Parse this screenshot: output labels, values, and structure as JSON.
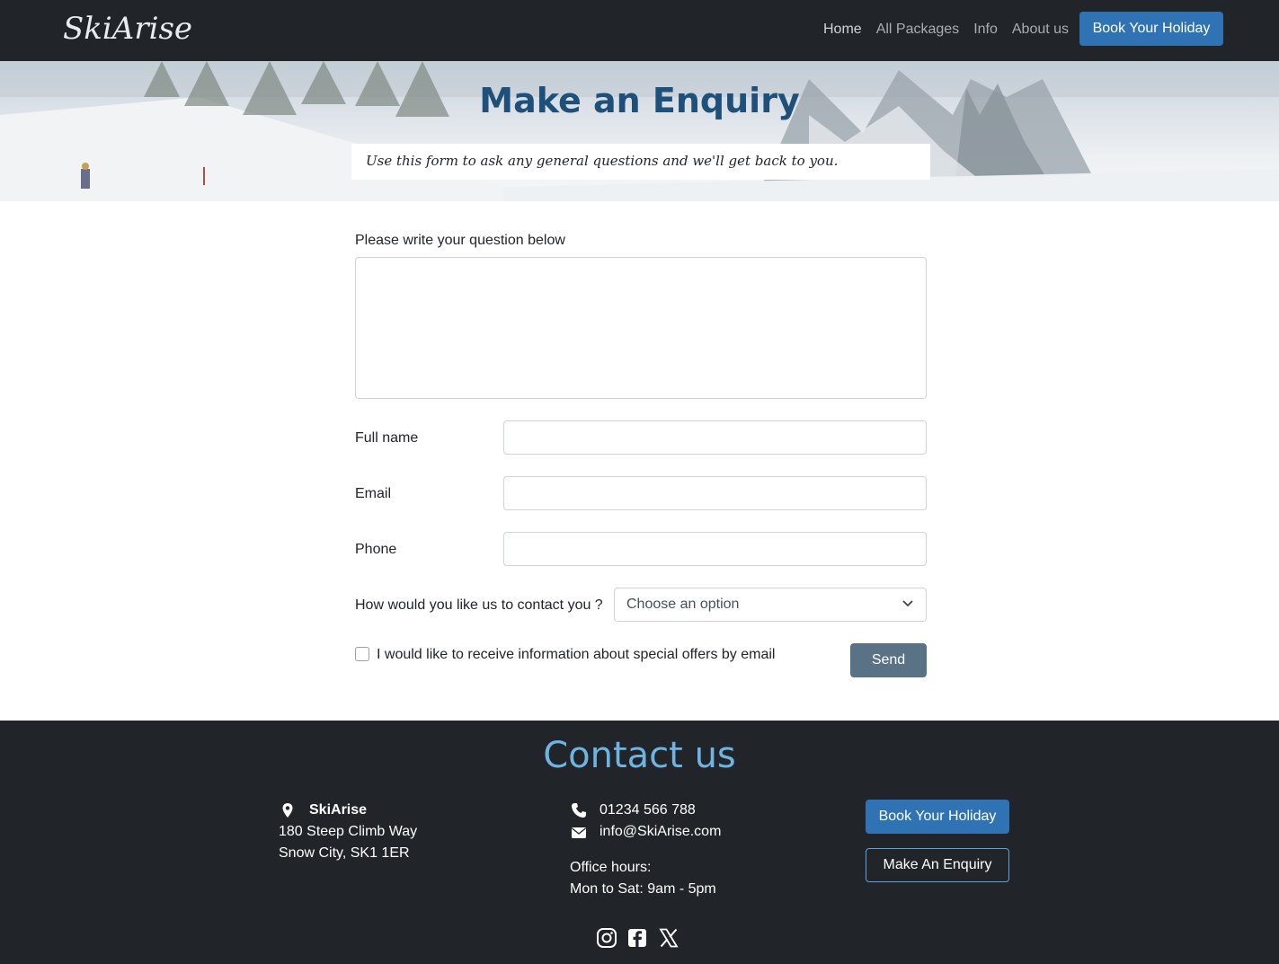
{
  "navbar": {
    "logo": "SkiArise",
    "links": [
      "Home",
      "All Packages",
      "Info",
      "About us"
    ],
    "book_button": "Book Your Holiday"
  },
  "hero": {
    "title": "Make an Enquiry",
    "subtitle": "Use this form to ask any general questions and we'll get back to you."
  },
  "form": {
    "question_label": "Please write your question below",
    "question_value": "",
    "fullname_label": "Full name",
    "fullname_value": "",
    "email_label": "Email",
    "email_value": "",
    "phone_label": "Phone",
    "phone_value": "",
    "contact_label": "How would you like us to contact you ?",
    "contact_selected": "Choose an option",
    "offers_label": "I would like to receive information about special offers by email",
    "offers_checked": false,
    "send_button": "Send"
  },
  "footer": {
    "title": "Contact us",
    "company": "SkiArise",
    "address_line1": "180 Steep Climb Way",
    "address_line2": "Snow City, SK1 1ER",
    "phone": "01234 566 788",
    "email": "info@SkiArise.com",
    "hours_label": "Office hours:",
    "hours_value": "Mon to Sat: 9am - 5pm",
    "book_button": "Book Your Holiday",
    "enquiry_button": "Make An Enquiry",
    "social_icons": [
      "instagram-icon",
      "facebook-icon",
      "x-icon"
    ]
  },
  "colors": {
    "navbar_bg": "#212529",
    "accent": "#2f73b5",
    "hero_title": "#1f5079",
    "footer_title": "#6fb3e0",
    "send_button": "#5a7286"
  }
}
